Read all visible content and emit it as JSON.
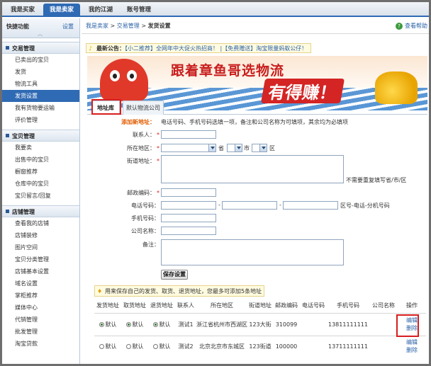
{
  "topnav": {
    "items": [
      "我是买家",
      "我是卖家",
      "我的江湖",
      "账号管理"
    ]
  },
  "sidebar": {
    "title": "快捷功能",
    "settings": "设置",
    "sections": [
      {
        "title": "交易管理",
        "items": [
          "已卖出的宝贝",
          "发货",
          "物流工具",
          "发货设置",
          "我有货物要运输",
          "评价管理"
        ]
      },
      {
        "title": "宝贝管理",
        "items": [
          "我要卖",
          "出售中的宝贝",
          "橱窗推荐",
          "仓库中的宝贝",
          "宝贝留言/回复"
        ]
      },
      {
        "title": "店铺管理",
        "items": [
          "查看我的店铺",
          "店铺装修",
          "图片空间",
          "宝贝分类管理",
          "店铺基本设置",
          "域名设置",
          "掌柜推荐",
          "媒体中心",
          "代销管理",
          "批发管理",
          "淘宝贷款"
        ]
      }
    ]
  },
  "breadcrumb": {
    "part1": "我是卖家",
    "sep": ">",
    "part2": "交易管理",
    "part3": "发货设置"
  },
  "help": "查看帮助",
  "notice": {
    "label": "最新公告：",
    "text": "【小二推荐】全网年中大促火热招商！ |【免费赠送】淘宝限量蚂蚁公仔！"
  },
  "banner": {
    "line1": "跟着章鱼哥选物流",
    "line2": "有得赚！"
  },
  "tabs": [
    "地址库",
    "默认物流公司"
  ],
  "form": {
    "add_title": "添加新地址：",
    "hint": "电话号码、手机号码选填一项，备注和公司名称为可填项，其余均为必填项",
    "contact_label": "联系人：",
    "region_label": "所在地区：",
    "province": "省",
    "city": "市",
    "district": "区",
    "street_label": "街道地址：",
    "street_hint": "不需要重复填写省/市/区",
    "zip_label": "邮政编码：",
    "phone_label": "电话号码：",
    "phone_dash1": "-",
    "phone_dash2": "-",
    "phone_hint": "区号-电话-分机号码",
    "mobile_label": "手机号码：",
    "company_label": "公司名称：",
    "remark_label": "备注：",
    "save_label": "保存设置",
    "required": "*"
  },
  "tip": "用来保存自己的发货、取货、退货地址，您最多可添加5条地址",
  "table": {
    "headers": [
      "发货地址",
      "取货地址",
      "退货地址",
      "联系人",
      "所在地区",
      "街道地址",
      "邮政编码",
      "电话号码",
      "手机号码",
      "公司名称",
      "操作"
    ],
    "rows": [
      {
        "ship": "默认",
        "pick": "默认",
        "ret": "默认",
        "contact": "测试1",
        "region": "浙江省杭州市西湖区",
        "street": "123大街",
        "zip": "310099",
        "phone": "",
        "mobile": "13811111111",
        "company": "",
        "edit": "编辑",
        "del": "删除",
        "ship_on": true,
        "pick_on": true,
        "ret_on": true
      },
      {
        "ship": "默认",
        "pick": "默认",
        "ret": "默认",
        "contact": "测试2",
        "region": "北京北京市东城区",
        "street": "123街道",
        "zip": "100000",
        "phone": "",
        "mobile": "13711111111",
        "company": "",
        "edit": "编辑",
        "del": "删除",
        "ship_on": false,
        "pick_on": false,
        "ret_on": false
      }
    ]
  },
  "colors": {
    "accent": "#2f6ab4",
    "highlight": "#d81e1e",
    "orange": "#e15b00"
  }
}
